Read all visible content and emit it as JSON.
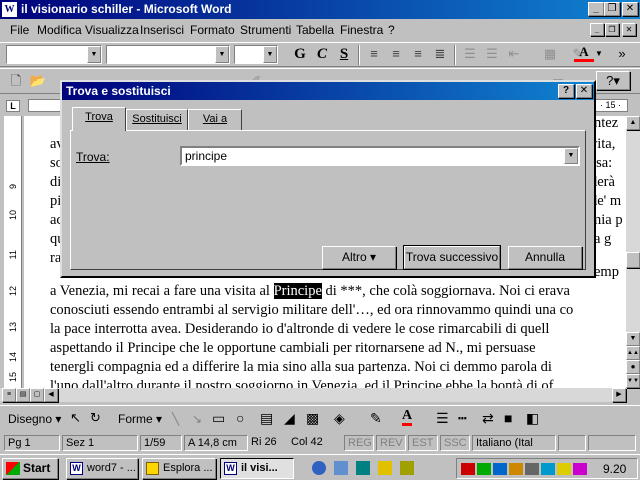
{
  "window": {
    "title": "il visionario schiller - Microsoft Word",
    "minimize": "_",
    "maximize": "❐",
    "close": "✕"
  },
  "menu": [
    "File",
    "Modifica",
    "Visualizza",
    "Inserisci",
    "Formato",
    "Strumenti",
    "Tabella",
    "Finestra",
    "?"
  ],
  "format_toolbar": {
    "bold": "G",
    "italic": "C",
    "underline": "S"
  },
  "ruler": {
    "right_label": "· 15 ·"
  },
  "vruler_labels": [
    "9",
    "10",
    "11",
    "12",
    "13",
    "14",
    "15"
  ],
  "document": {
    "lines_behind": [
      {
        "left": "av",
        "right": "vita,"
      },
      {
        "left": "so",
        "right": "essa:"
      },
      {
        "left": "di",
        "right": "derà"
      },
      {
        "left": "pi",
        "right": "de' m"
      },
      {
        "left": "ac",
        "right": "mia p"
      },
      {
        "left": "qu",
        "right": "a g"
      },
      {
        "left": "ra",
        "right": "emp"
      }
    ],
    "line_partial_right": "ntez",
    "line1_before": "a Venezia, mi recai a fare una visita al ",
    "line1_highlight": "Principe",
    "line1_after": " di ***, che colà soggiornava. Noi ci erava",
    "lines": [
      "conosciuti essendo entrambi al servigio militare dell'…, ed ora rinnovammo quindi una co",
      "la pace interrotta avea. Desiderando io d'altronde di vedere le cose rimarcabili di quell",
      "aspettando il Principe che le opportune cambiali per ritornarsene ad N., mi persuase",
      "tenergli compagnia ed a differire la mia sino alla sua partenza. Noi ci demmo parola di",
      "l'uno dall'altro durante il nostro soggiorno in Venezia, ed il Principe ebbe la bontà di of"
    ]
  },
  "dialog": {
    "title": "Trova e sostituisci",
    "help": "?",
    "close": "✕",
    "tabs": [
      "Trova",
      "Sostituisci",
      "Vai a"
    ],
    "find_label": "Trova:",
    "find_value": "principe",
    "btn_more": "Altro ▾",
    "btn_find_next": "Trova successivo",
    "btn_cancel": "Annulla"
  },
  "drawing": {
    "disegno": "Disegno ▾",
    "forme": "Forme ▾"
  },
  "status": {
    "page": "Pg 1",
    "section": "Sez 1",
    "pages": "1/59",
    "position": "A 14,8 cm",
    "row": "Ri 26",
    "col": "Col 42",
    "reg": "REG",
    "rev": "REV",
    "est": "EST",
    "ssc": "SSC",
    "language": "Italiano (Ital"
  },
  "taskbar": {
    "start": "Start",
    "tasks": [
      "word7 - ...",
      "Esplora ...",
      "il visi..."
    ],
    "clock": "9.20"
  },
  "colors": {
    "title_gradient_start": "#00007b",
    "title_gradient_end": "#1084d0",
    "font_color_red": "#ff0000"
  }
}
